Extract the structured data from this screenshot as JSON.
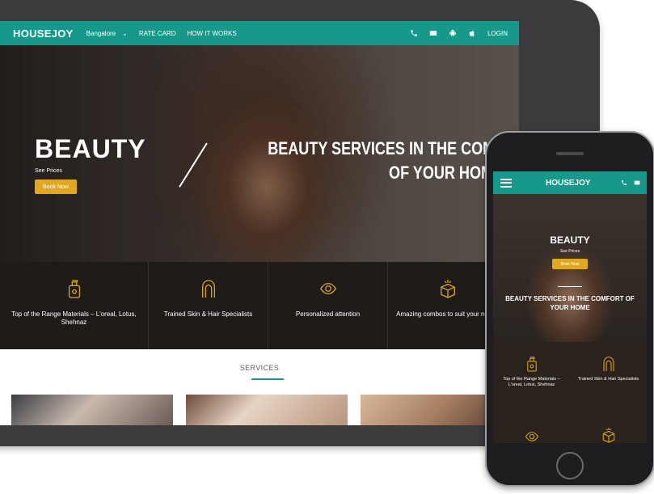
{
  "desktop": {
    "logo": "HOUSEJOY",
    "city": "Bangalore",
    "nav_links": [
      "RATE CARD",
      "HOW IT WORKS"
    ],
    "nav_icons": [
      "phone-icon",
      "mail-icon",
      "android-icon",
      "apple-icon"
    ],
    "login": "LOGIN",
    "hero": {
      "title": "BEAUTY",
      "subtitle": "See Prices",
      "button": "Book Now",
      "tagline_line1": "BEAUTY SERVICES IN THE COMFORT",
      "tagline_line2": "OF YOUR HOM"
    },
    "features": [
      {
        "icon": "product-bottle-icon",
        "text": "Top of the Range Materials – L'oreal, Lotus, Shehnaz"
      },
      {
        "icon": "hair-icon",
        "text": "Trained Skin & Hair Specialists"
      },
      {
        "icon": "eye-icon",
        "text": "Personalized attention"
      },
      {
        "icon": "combo-box-icon",
        "text": "Amazing combos to suit your needs"
      }
    ],
    "services_title": "SERVICES"
  },
  "mobile": {
    "logo": "HOUSEJOY",
    "nav_icons": [
      "phone-icon",
      "mail-icon"
    ],
    "hero": {
      "title": "BEAUTY",
      "subtitle": "See Prices",
      "button": "Book Now",
      "tagline": "BEAUTY SERVICES IN THE COMFORT OF YOUR HOME"
    },
    "features": [
      {
        "icon": "product-bottle-icon",
        "text": "Top of the Range Materials – L'oreal, Lotus, Shehnaz"
      },
      {
        "icon": "hair-icon",
        "text": "Trained Skin & Hair Specialists"
      },
      {
        "icon": "eye-icon",
        "text": ""
      },
      {
        "icon": "combo-box-icon",
        "text": ""
      }
    ]
  },
  "colors": {
    "brand_teal": "#16998b",
    "accent_gold": "#e0a81f",
    "feature_bg": "#1f1b18"
  }
}
